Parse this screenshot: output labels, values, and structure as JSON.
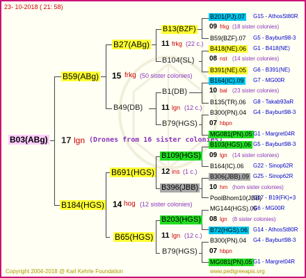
{
  "header": {
    "date": "23- 10-2018 ( 21: 58)"
  },
  "footer": {
    "copyright": "Copyright 2004-2018 @ Karl Kehrle Foundation",
    "site": "www.pedigreeapis.org"
  },
  "root": {
    "name": "B03(ABg)",
    "num": "17",
    "breed": "lgn",
    "note": "(Drones from 16 sister colonies)"
  },
  "gen1": [
    {
      "name": "B59(ABg)",
      "num": "15",
      "breed": "frkg",
      "note": "(50 sister colonies)"
    },
    {
      "name": "B184(HGS)",
      "num": "14",
      "breed": "hog",
      "note": "(12 sister colonies)"
    }
  ],
  "gen2": [
    {
      "name": "B27(ABg)",
      "num": "11",
      "breed": "frkg",
      "note": "(22 c.)"
    },
    {
      "name": "B49(DB)",
      "num": "11",
      "breed": "lgn",
      "note": "(12 c.)"
    },
    {
      "name": "B691(HGS)",
      "num": "12",
      "breed": "ins",
      "note": "(1 c.)"
    },
    {
      "name": "B65(HGS)",
      "num": "11",
      "breed": "lgn",
      "note": "(12 c.)"
    }
  ],
  "gen3": [
    {
      "name": "B13(BZF)"
    },
    {
      "name": "B104(SL)"
    },
    {
      "name": "B1(DB)"
    },
    {
      "name": "B79(HGS)"
    },
    {
      "name": "B109(HGS)"
    },
    {
      "name": "B396(JBB)"
    },
    {
      "name": "B203(HGS)"
    },
    {
      "name": "B79(HGS)"
    }
  ],
  "gen4": [
    {
      "name": "B201(PJ).07",
      "info": "G15 - AthosSt80R"
    },
    {
      "num": "09",
      "text": "frkg",
      "note": "(18 sister colonies)"
    },
    {
      "name": "B59(BZF).07",
      "info": "G5 - Bayburt98-3"
    },
    {
      "name": "B418(NE).06",
      "info": "G1 - B418(NE)"
    },
    {
      "num": "08",
      "text": "nst",
      "note": "(14 sister colonies)"
    },
    {
      "name": "B391(NE).05",
      "info": "G6 - B391(NE)"
    },
    {
      "name": "B164(IC).09",
      "info": "G7 - MG00R"
    },
    {
      "num": "10",
      "text": "bal",
      "note": "(23 sister colonies)"
    },
    {
      "name": "B135(TR).06",
      "info": "G8 - Takab93aR"
    },
    {
      "name": "B300(PN).04",
      "info": "G4 - Bayburt98-3"
    },
    {
      "num": "07",
      "text": "hbpn",
      "note": ""
    },
    {
      "name": "MG081(PN).05",
      "info": "G1 - Margret04R"
    },
    {
      "name": "B103(HGS).06",
      "info": "G5 - Bayburt98-3"
    },
    {
      "num": "09",
      "text": "lgn",
      "note": "(14 sister colonies)"
    },
    {
      "name": "B164(IC).06",
      "info": "G22 - Sinop62R"
    },
    {
      "name": "B306(JBB).09",
      "info": "G25 - Sinop62R"
    },
    {
      "num": "10",
      "text": "hm",
      "note": "(hom sister colonies)"
    },
    {
      "name": "PoolBhom10(JBB)",
      "info": "G17 - B19(FK)+3"
    },
    {
      "name": "MG144(HGS).06",
      "info": "G6 - MG00R"
    },
    {
      "num": "08",
      "text": "lgn",
      "note": "(8 sister colonies)"
    },
    {
      "name": "B72(HGS).06",
      "info": "G14 - AthosSt80R"
    },
    {
      "name": "B300(PN).04",
      "info": "G4 - Bayburt98-3"
    },
    {
      "num": "07",
      "text": "hbpn",
      "note": ""
    },
    {
      "name": "MG081(PN).05",
      "info": "G1 - Margret04R"
    }
  ]
}
